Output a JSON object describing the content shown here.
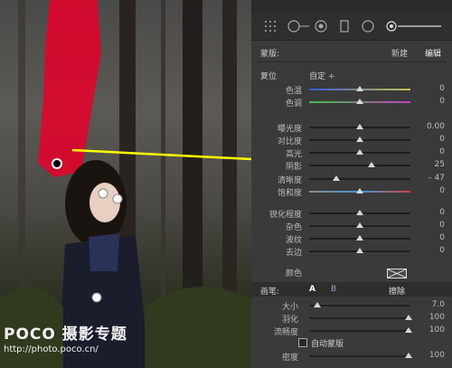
{
  "panel": {
    "header_title": "蒙版:",
    "new_label": "新建",
    "edit_label": "编辑",
    "preset_label": "复位",
    "preset_value": "自定 ÷",
    "color_label": "颜色"
  },
  "sliders": [
    {
      "label": "色温",
      "value": "0",
      "pos": 0.5,
      "track": "temp"
    },
    {
      "label": "色调",
      "value": "0",
      "pos": 0.5,
      "track": "tint"
    },
    {
      "label": "曝光度",
      "value": "0.00",
      "pos": 0.5,
      "track": "gray"
    },
    {
      "label": "对比度",
      "value": "0",
      "pos": 0.5,
      "track": "gray"
    },
    {
      "label": "高光",
      "value": "0",
      "pos": 0.5,
      "track": "gray"
    },
    {
      "label": "阴影",
      "value": "25",
      "pos": 0.62,
      "track": "gray"
    },
    {
      "label": "清晰度",
      "value": "– 47",
      "pos": 0.27,
      "track": "gray"
    },
    {
      "label": "饱和度",
      "value": "0",
      "pos": 0.5,
      "track": "sat"
    },
    {
      "label": "锐化程度",
      "value": "0",
      "pos": 0.5,
      "track": "gray"
    },
    {
      "label": "杂色",
      "value": "0",
      "pos": 0.5,
      "track": "gray"
    },
    {
      "label": "波纹",
      "value": "0",
      "pos": 0.5,
      "track": "gray"
    },
    {
      "label": "去边",
      "value": "0",
      "pos": 0.5,
      "track": "gray"
    }
  ],
  "brush": {
    "label": "画笔:",
    "a_label": "A",
    "b_label": "B",
    "erase_label": "擦除",
    "rows": [
      {
        "label": "大小",
        "value": "7.0",
        "pos": 0.08
      },
      {
        "label": "羽化",
        "value": "100",
        "pos": 0.98
      },
      {
        "label": "流畅度",
        "value": "100",
        "pos": 0.98
      }
    ],
    "automask_label": "自动蒙版",
    "density_label": "密度",
    "density_value": "100",
    "density_pos": 0.98
  },
  "watermark": {
    "brand_a": "POCO",
    "brand_b": "摄影专题",
    "url": "http://photo.poco.cn/"
  },
  "colors": {
    "annotation_arrow": "#ffff00",
    "mask_overlay": "#e8002a"
  }
}
